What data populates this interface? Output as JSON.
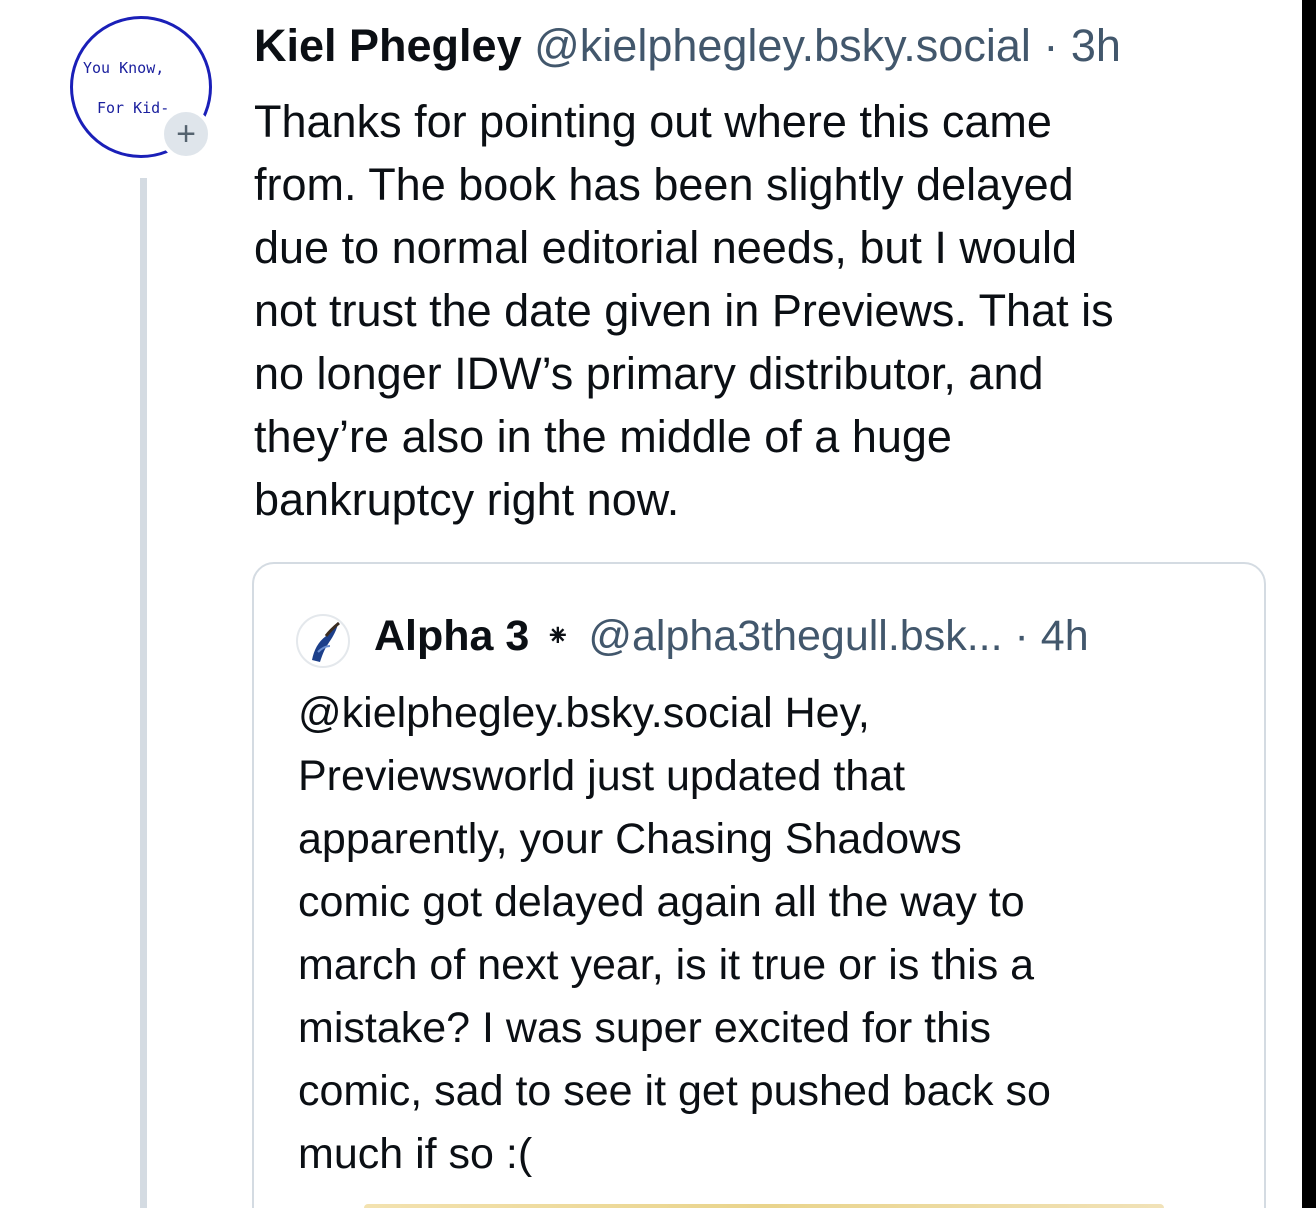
{
  "post": {
    "avatar_text_line1": "You Know,",
    "avatar_text_line2": "For Kid-",
    "follow_symbol": "+",
    "author_name": "Kiel Phegley",
    "handle": "@kielphegley.bsky.social",
    "separator": " · ",
    "time": "3h",
    "text": "Thanks for pointing out where this came\nfrom. The book has been slightly delayed\ndue to normal editorial needs, but I would\nnot trust the date given in Previews. That is\nno longer IDW’s primary distributor, and\nthey’re also in the middle of a huge\nbankruptcy right now."
  },
  "quote": {
    "author_name": "Alpha 3",
    "badge_symbol": "⁕",
    "handle": "@alpha3thegull.bsk...",
    "separator": " · ",
    "time": "4h",
    "text": "@kielphegley.bsky.social Hey,\nPreviewsworld just updated that\napparently, your Chasing Shadows\ncomic got delayed again all the way to\nmarch of next year, is it true or is this a\nmistake? I was super excited for this\ncomic, sad to see it get pushed back so\nmuch if so :("
  },
  "colors": {
    "text_primary": "#0b0f14",
    "text_secondary": "#42576c",
    "thread_line": "#d4dbe2",
    "avatar_ring": "#1a1fb8"
  },
  "icons": {
    "follow_badge": "plus-icon",
    "quote_avatar": "gull-avatar-icon"
  }
}
